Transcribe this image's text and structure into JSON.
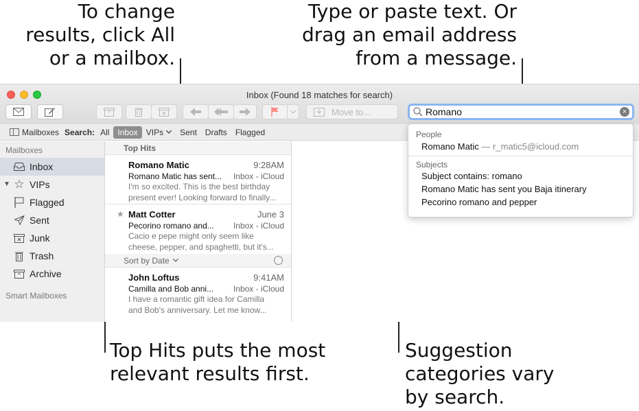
{
  "callouts": {
    "top_left": "To change\nresults, click All\nor a mailbox.",
    "top_right": "Type or paste text. Or\ndrag an email address\nfrom a message.",
    "bottom_left": "Top Hits puts the most\nrelevant results first.",
    "bottom_right": "Suggestion\ncategories vary\nby search."
  },
  "window": {
    "title": "Inbox (Found 18 matches for search)"
  },
  "toolbar": {
    "move_to_label": "Move to...",
    "search_value": "Romano",
    "icons": [
      "compose-envelope-icon",
      "compose-pencil-icon",
      "archive-icon",
      "trash-icon",
      "junk-icon",
      "reply-icon",
      "reply-all-icon",
      "forward-icon",
      "flag-icon",
      "chevron-down-icon",
      "move-to-icon",
      "search-icon",
      "clear-search-icon"
    ]
  },
  "scopebar": {
    "mailboxes_label": "Mailboxes",
    "search_label": "Search:",
    "scopes": [
      "All",
      "Inbox",
      "VIPs",
      "Sent",
      "Drafts",
      "Flagged"
    ],
    "active_scope": "Inbox"
  },
  "sidebar": {
    "heading": "Mailboxes",
    "items": [
      {
        "label": "Inbox",
        "icon": "inbox-icon"
      },
      {
        "label": "VIPs",
        "icon": "star-icon"
      },
      {
        "label": "Flagged",
        "icon": "flag-icon"
      },
      {
        "label": "Sent",
        "icon": "paper-plane-icon"
      },
      {
        "label": "Junk",
        "icon": "junk-icon"
      },
      {
        "label": "Trash",
        "icon": "trash-icon"
      },
      {
        "label": "Archive",
        "icon": "archive-icon"
      }
    ],
    "smart_heading": "Smart Mailboxes"
  },
  "message_list": {
    "top_hits_label": "Top Hits",
    "sort_label": "Sort by Date",
    "top_hits": [
      {
        "from": "Romano Matic",
        "time": "9:28AM",
        "subject": "Romano Matic has sent...",
        "mailbox": "Inbox - iCloud",
        "preview1": "I'm so excited. This is the best birthday",
        "preview2": "present ever! Looking forward to finally..."
      },
      {
        "from": "Matt Cotter",
        "time": "June 3",
        "subject": "Pecorino romano and...",
        "mailbox": "Inbox - iCloud",
        "preview1": "Cacio e pepe might only seem like",
        "preview2": "cheese, pepper, and spaghetti, but it's..."
      }
    ],
    "others": [
      {
        "from": "John Loftus",
        "time": "9:41AM",
        "subject": "Camilla and Bob anni...",
        "mailbox": "Inbox - iCloud",
        "preview1": "I have a romantic gift idea for Camilla",
        "preview2": "and Bob's anniversary. Let me know..."
      }
    ]
  },
  "suggestions": {
    "people_heading": "People",
    "person_name": "Romano Matic",
    "person_email": "— r_matic5@icloud.com",
    "subjects_heading": "Subjects",
    "subjects": [
      "Subject contains: romano",
      "Romano Matic has sent you Baja itinerary",
      "Pecorino romano and pepper"
    ]
  },
  "colors": {
    "scope_active_bg": "#8e8e8e",
    "sidebar_selected_bg": "#d7dce4",
    "search_focus_ring": "#8ab6f0",
    "flag_red": "#ff5b57"
  }
}
